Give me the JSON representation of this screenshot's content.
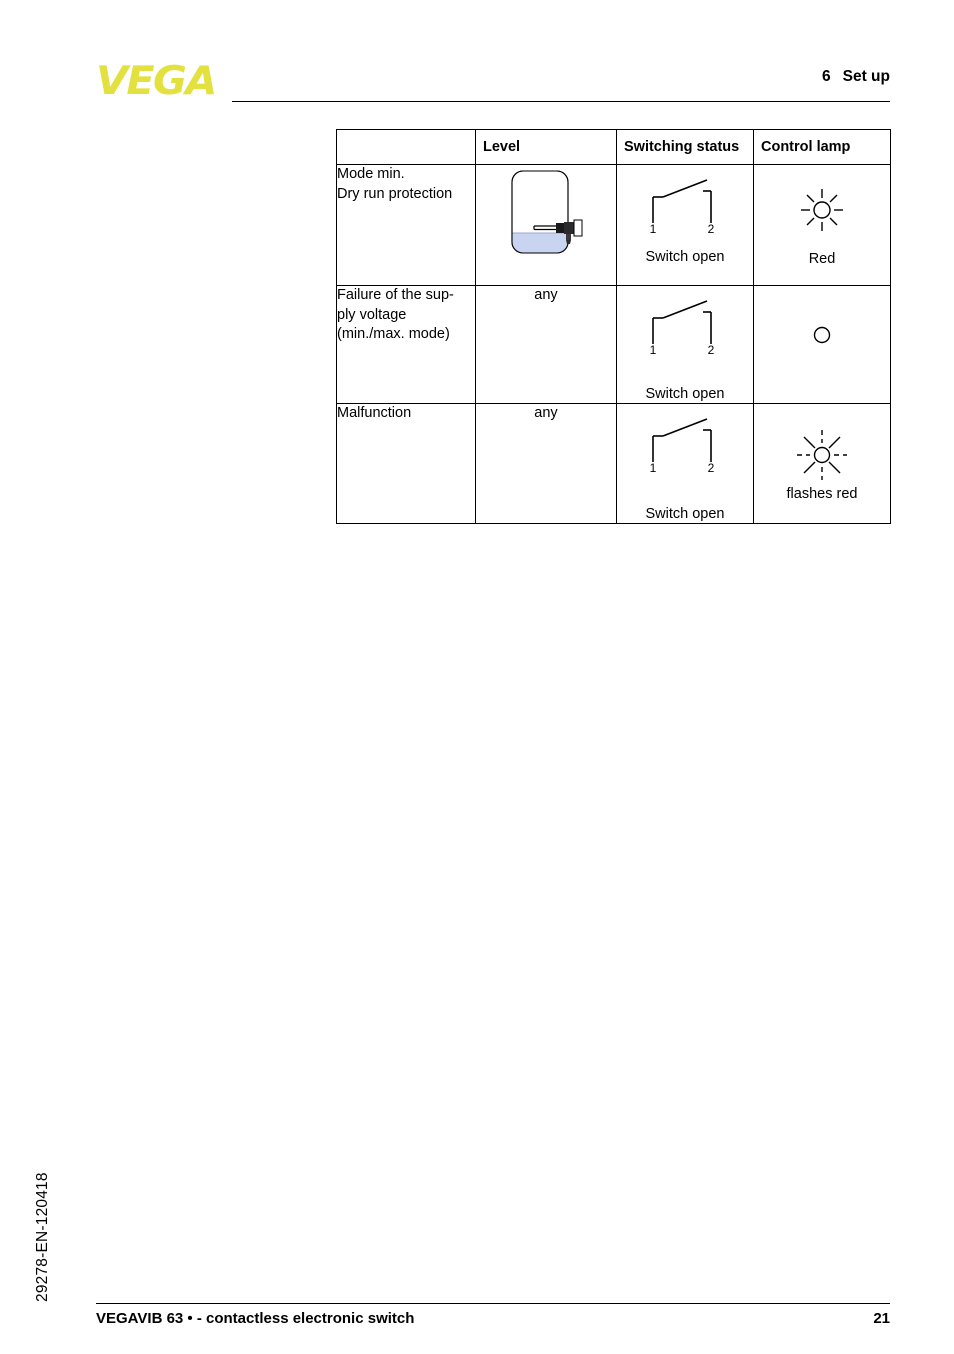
{
  "header": {
    "logo_text": "VEGA",
    "logo_color": "#e3e13f",
    "chapter_number": "6",
    "chapter_title": "Set up"
  },
  "table": {
    "columns": [
      "",
      "Level",
      "Switching status",
      "Control lamp"
    ],
    "rows": [
      {
        "description_lines": [
          "Mode min.",
          "Dry run protection"
        ],
        "level_type": "vessel-diagram",
        "level_text": "",
        "switch_terminal_1": "1",
        "switch_terminal_2": "2",
        "switch_caption": "Switch open",
        "lamp_state": "lit",
        "lamp_caption": "Red"
      },
      {
        "description_lines": [
          "Failure of the sup-",
          "ply voltage",
          "(min./max. mode)"
        ],
        "level_type": "text",
        "level_text": "any",
        "switch_terminal_1": "1",
        "switch_terminal_2": "2",
        "switch_caption": "Switch open",
        "lamp_state": "off",
        "lamp_caption": ""
      },
      {
        "description_lines": [
          "Malfunction"
        ],
        "level_type": "text",
        "level_text": "any",
        "switch_terminal_1": "1",
        "switch_terminal_2": "2",
        "switch_caption": "Switch open",
        "lamp_state": "flashing",
        "lamp_caption": "flashes red"
      }
    ]
  },
  "vessel": {
    "liquid_color": "#c8d4f0",
    "outline_color": "#000000"
  },
  "footer": {
    "document_code": "29278-EN-120418",
    "title": "VEGAVIB 63 • - contactless electronic switch",
    "page_number": "21"
  }
}
